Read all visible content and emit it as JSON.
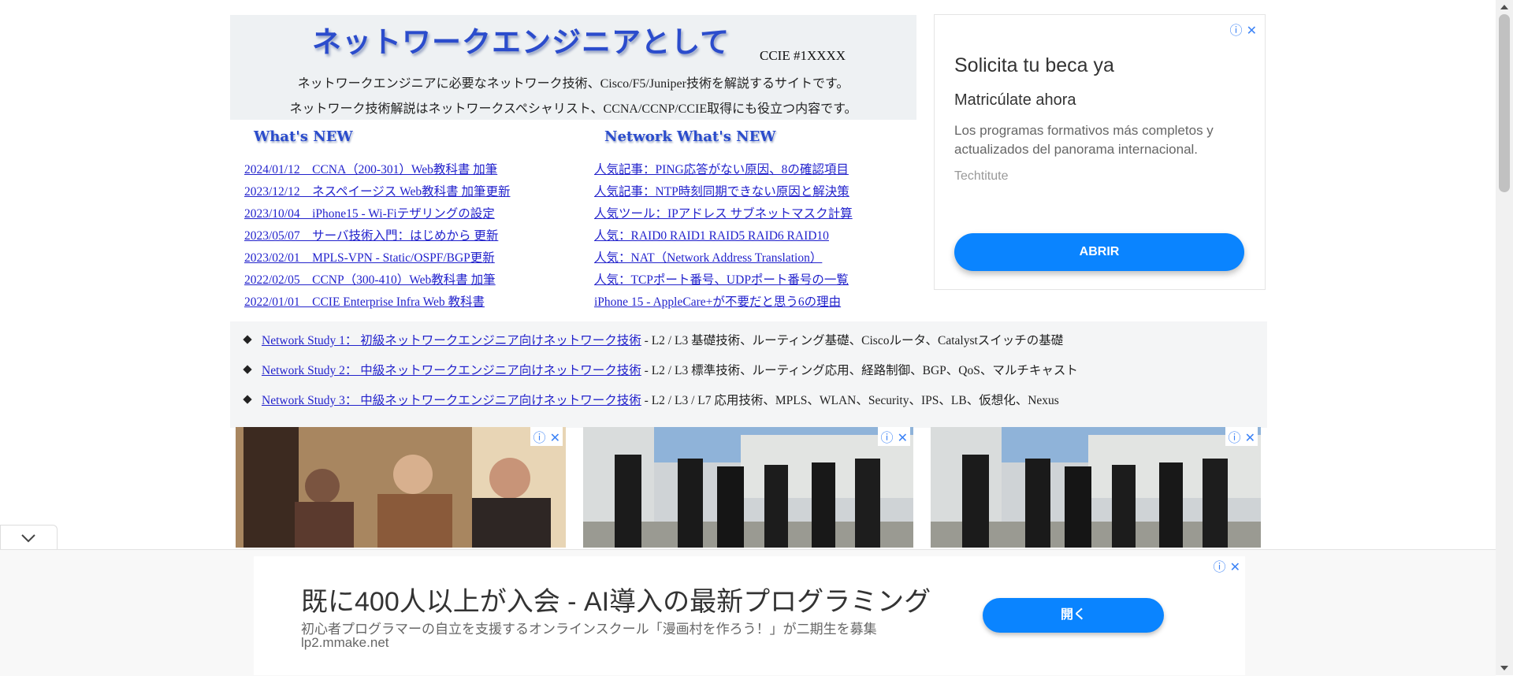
{
  "header": {
    "logo_text": "ネットワークエンジニアとして",
    "ccie": "CCIE #1XXXX",
    "desc1": "ネットワークエンジニアに必要なネットワーク技術、Cisco/F5/Juniper技術を解説するサイトです。",
    "desc2": "ネットワーク技術解説はネットワークスペシャリスト、CCNA/CCNP/CCIE取得にも役立つ内容です。"
  },
  "whats_new": {
    "title": "What's NEW",
    "items": [
      "2024/01/12　CCNA（200-301）Web教科書 加筆",
      "2023/12/12　ネスペイージス Web教科書 加筆更新",
      "2023/10/04　iPhone15 - Wi-Fiテザリングの設定",
      "2023/05/07　サーバ技術入門：はじめから 更新",
      "2023/02/01　MPLS-VPN - Static/OSPF/BGP更新",
      "2022/02/05　CCNP（300-410）Web教科書 加筆",
      "2022/01/01　CCIE Enterprise Infra Web 教科書"
    ]
  },
  "network_whats_new": {
    "title": "Network What's NEW",
    "items": [
      "人気記事：PING応答がない原因、8の確認項目",
      "人気記事：NTP時刻同期できない原因と解決策",
      "人気ツール：IPアドレス サブネットマスク計算",
      "人気：RAID0 RAID1 RAID5 RAID6 RAID10",
      "人気：NAT（Network Address Translation）",
      "人気：TCPポート番号、UDPポート番号の一覧",
      "iPhone 15 - AppleCare+が不要だと思う6の理由"
    ]
  },
  "studies": [
    {
      "link": "Network Study 1： 初級ネットワークエンジニア向けネットワーク技術",
      "desc": " - L2 / L3 基礎技術、ルーティング基礎、Ciscoルータ、Catalystスイッチの基礎"
    },
    {
      "link": "Network Study 2： 中級ネットワークエンジニア向けネットワーク技術",
      "desc": " - L2 / L3 標準技術、ルーティング応用、経路制御、BGP、QoS、マルチキャスト"
    },
    {
      "link": "Network Study 3： 中級ネットワークエンジニア向けネットワーク技術",
      "desc": " - L2 / L3 / L7 応用技術、MPLS、WLAN、Security、IPS、LB、仮想化、Nexus"
    }
  ],
  "side_ad": {
    "headline": "Solicita tu beca ya",
    "subheadline": "Matricúlate ahora",
    "body": "Los programas formativos más completos y actualizados del panorama internacional.",
    "source": "Techtitute",
    "button": "ABRIR",
    "info_icon": "ⓘ",
    "close_icon": "✕"
  },
  "bottom_ad": {
    "title": "既に400人以上が入会 - AI導入の最新プログラミング",
    "subtitle": "初心者プログラマーの自立を支援するオンラインスクール「漫画村を作ろう！」が二期生を募集",
    "url": "lp2.mmake.net",
    "button": "開く",
    "info_icon": "ⓘ",
    "close_icon": "✕"
  },
  "icons": {
    "collapse": "chevron-down-icon",
    "ad_info": "info-icon",
    "ad_close": "close-icon"
  },
  "colors": {
    "link": "#2222cc",
    "logo": "#2b4ccc",
    "ad_button": "#0a84ff",
    "header_bg": "#eef1f3"
  }
}
